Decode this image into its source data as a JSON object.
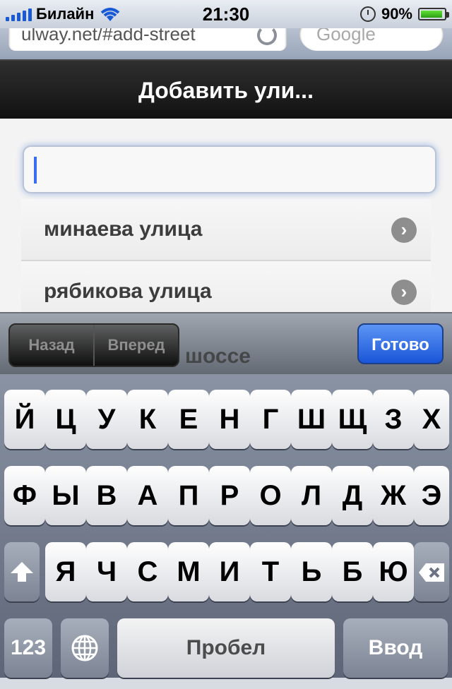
{
  "status_bar": {
    "carrier": "Билайн",
    "time": "21:30",
    "battery_percent": "90%",
    "battery_level": 0.9
  },
  "browser": {
    "url": "ulway.net/#add-street",
    "search_placeholder": "Google"
  },
  "header": {
    "title": "Добавить ули..."
  },
  "street_input": {
    "value": "",
    "placeholder": ""
  },
  "suggestions": [
    {
      "label": "минаева улица"
    },
    {
      "label": "рябикова улица"
    }
  ],
  "partially_hidden_suggestion": "шоссе",
  "accessory": {
    "prev": "Назад",
    "next": "Вперед",
    "done": "Готово"
  },
  "keyboard": {
    "row1": [
      "Й",
      "Ц",
      "У",
      "К",
      "Е",
      "Н",
      "Г",
      "Ш",
      "Щ",
      "З",
      "Х"
    ],
    "row2": [
      "Ф",
      "Ы",
      "В",
      "А",
      "П",
      "Р",
      "О",
      "Л",
      "Д",
      "Ж",
      "Э"
    ],
    "row3": [
      "Я",
      "Ч",
      "С",
      "М",
      "И",
      "Т",
      "Ь",
      "Б",
      "Ю"
    ],
    "numbers_key": "123",
    "space_key": "Пробел",
    "return_key": "Ввод"
  },
  "colors": {
    "accent_blue": "#1a55d8",
    "header_bg": "#1a1a1a"
  }
}
